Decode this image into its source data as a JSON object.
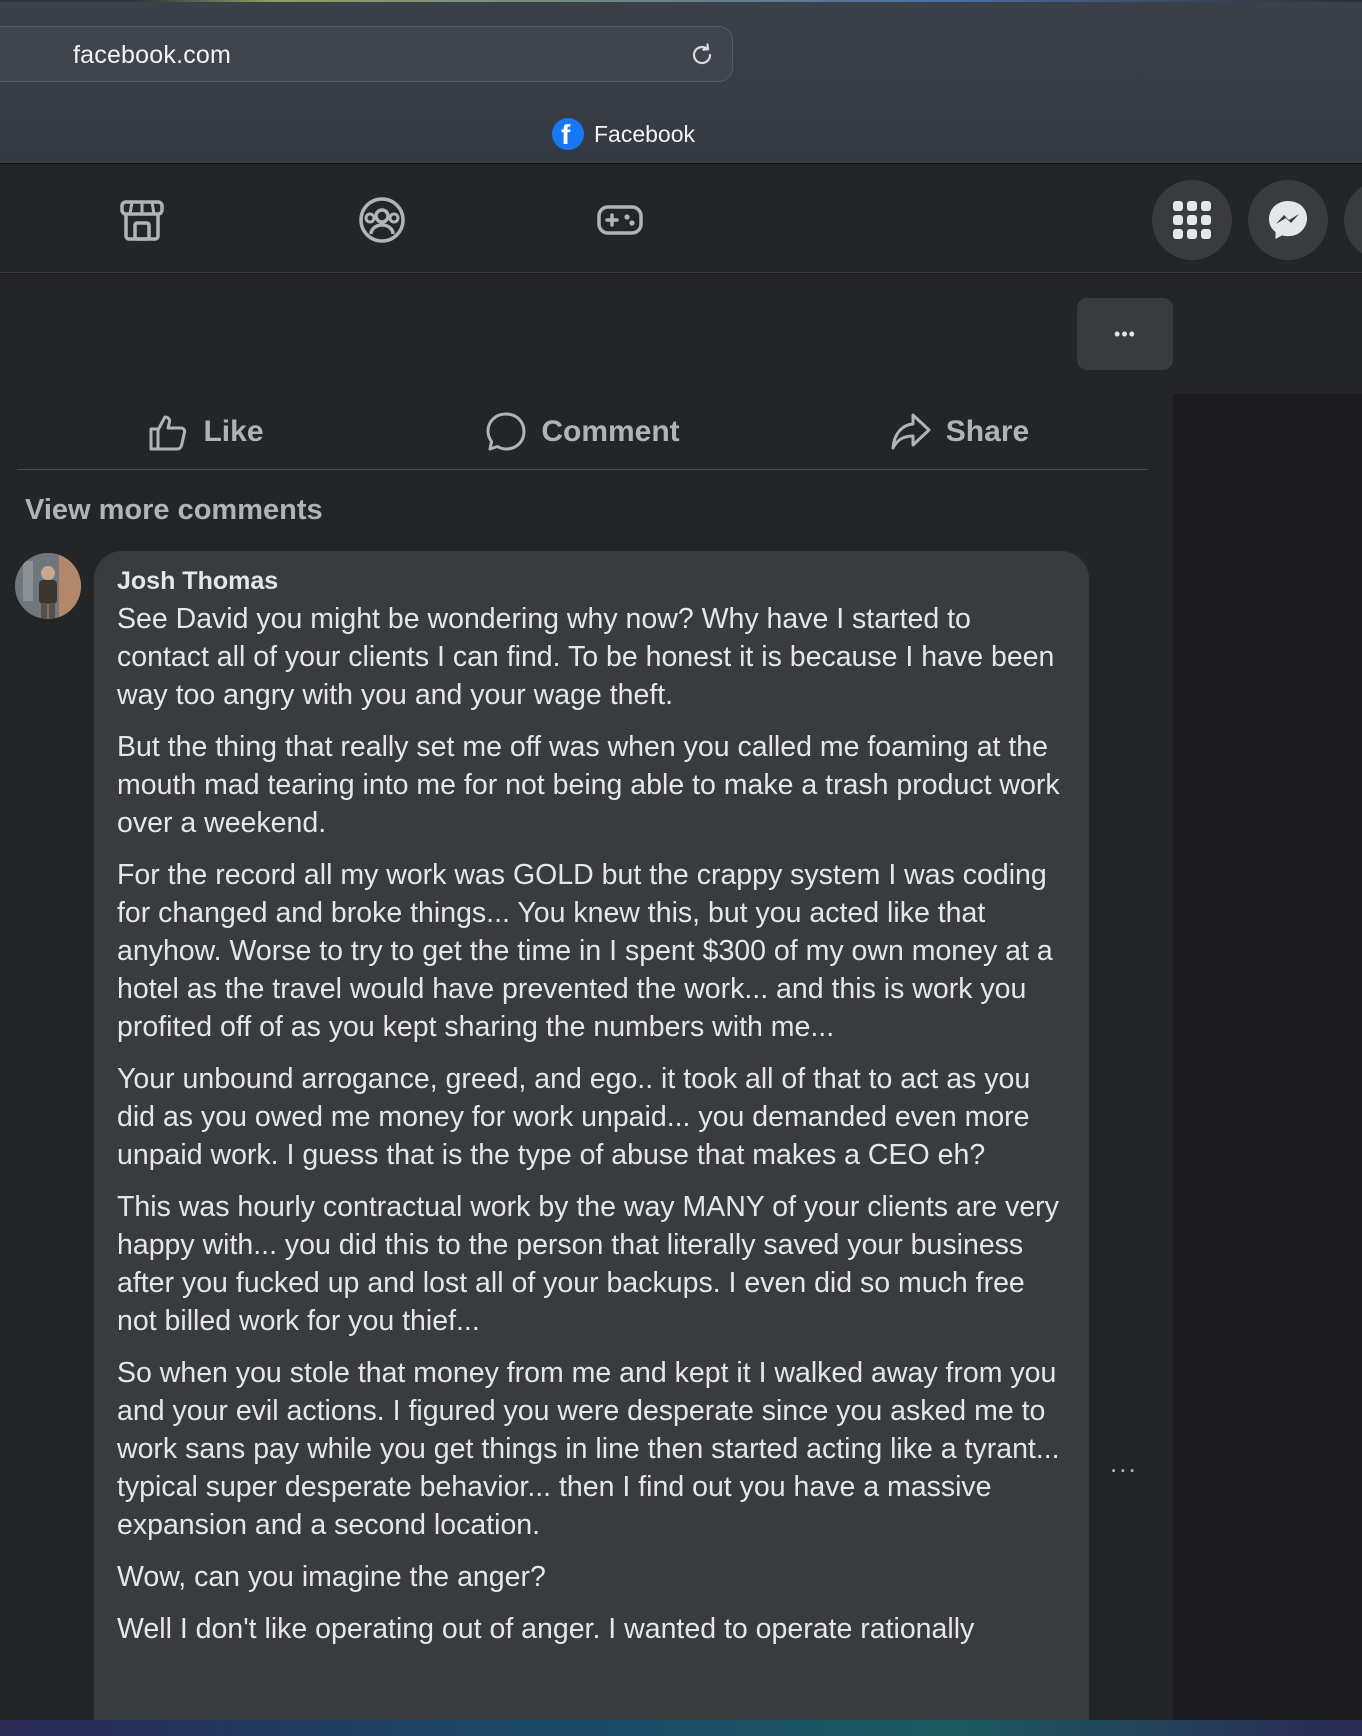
{
  "browser": {
    "address": "facebook.com",
    "tab_title": "Facebook"
  },
  "icons": {
    "marketplace": "marketplace-icon",
    "groups": "groups-icon",
    "gaming": "gaming-icon",
    "menu": "grid-menu-icon",
    "messenger": "messenger-icon"
  },
  "post": {
    "more_label": "•••",
    "actions": {
      "like": "Like",
      "comment": "Comment",
      "share": "Share"
    },
    "view_more": "View more comments"
  },
  "comment": {
    "author": "Josh Thomas",
    "paragraphs": [
      "See David you might be wondering why now? Why have I started to contact all of your clients I can find. To be honest it is because I have been way too angry with you and your wage theft.",
      "But the thing that really set me off was when you called me foaming at the mouth mad tearing into me for not being able to make a trash product work over a weekend.",
      "For the record all my work was GOLD but the crappy system I was coding for changed and broke things... You knew this, but you acted like that anyhow. Worse to try to get the time in I spent $300 of my own money at a hotel as the travel would have prevented the work... and this is work you profited off of as you kept sharing the numbers with me...",
      "Your unbound arrogance, greed, and ego.. it took all of that to act as you did as you owed me money for work unpaid... you demanded even more unpaid work. I guess that is the type of abuse that makes a CEO eh?",
      "This was hourly contractual work by the way MANY of your clients are very happy with... you did this to the person that literally saved your business after you fucked up and lost all of your backups. I even did so much free not billed work for you thief...",
      "So when you stole that money from me and kept it I walked away from you and your evil actions. I figured you were desperate since you asked me to work sans pay while you get things in line then started acting like a tyrant... typical super desperate behavior... then I find out you have a massive expansion and a second location.",
      "Wow, can you imagine the anger?",
      "Well I don't like operating out of anger. I wanted to operate rationally"
    ],
    "more_label": "..."
  }
}
